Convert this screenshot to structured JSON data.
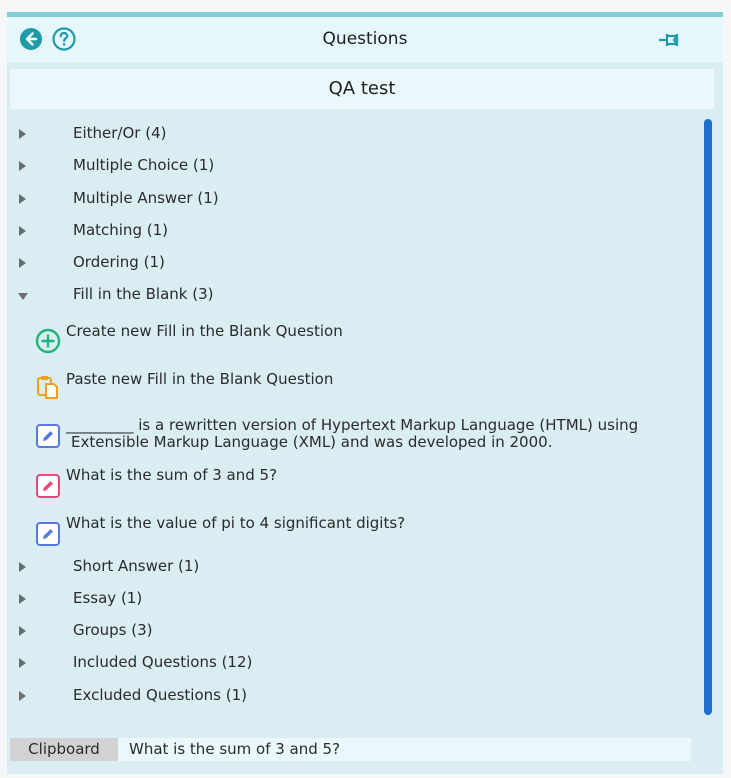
{
  "header": {
    "title": "Questions",
    "icons": [
      "back-arrow-icon",
      "help-icon",
      "pin-icon"
    ]
  },
  "subheader": {
    "title": "QA test"
  },
  "categories": [
    {
      "label": "Either/Or (4)",
      "expanded": false
    },
    {
      "label": "Multiple Choice (1)",
      "expanded": false
    },
    {
      "label": "Multiple Answer (1)",
      "expanded": false
    },
    {
      "label": "Matching (1)",
      "expanded": false
    },
    {
      "label": "Ordering (1)",
      "expanded": false
    },
    {
      "label": "Fill in the Blank (3)",
      "expanded": true
    },
    {
      "label": "Short Answer (1)",
      "expanded": false
    },
    {
      "label": "Essay (1)",
      "expanded": false
    },
    {
      "label": "Groups (3)",
      "expanded": false
    },
    {
      "label": "Included Questions (12)",
      "expanded": false
    },
    {
      "label": "Excluded Questions (1)",
      "expanded": false
    }
  ],
  "fill_in_blank": {
    "create_label": "Create new Fill in the Blank Question",
    "paste_label": "Paste new Fill in the Blank Question",
    "questions": [
      {
        "line1": "_________ is a rewritten version of Hypertext Markup Language (HTML) using",
        "line2": "Extensible Markup Language (XML) and was developed in 2000.",
        "icon_color": "#5b78e0"
      },
      {
        "line1": "What is the sum of 3 and 5?",
        "line2": "",
        "icon_color": "#e8467c"
      },
      {
        "line1": "What is the value of pi to 4 significant digits?",
        "line2": "",
        "icon_color": "#5b78e0"
      }
    ]
  },
  "clipboard": {
    "label": "Clipboard",
    "value": "What is the sum of 3 and 5?"
  },
  "colors": {
    "panel_bg": "#d9edf3",
    "header_bg": "#e6f7fb",
    "accent_top": "#86cfd9",
    "header_icon": "#1e9aa8",
    "scrollbar": "#1e6fd0",
    "create_icon": "#1fb87a",
    "paste_icon": "#f0a020"
  }
}
